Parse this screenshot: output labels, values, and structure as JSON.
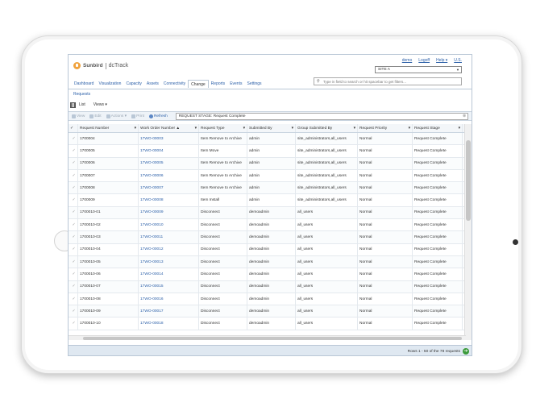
{
  "header": {
    "brand": "Sunbird",
    "product": "dcTrack",
    "links": [
      "demo",
      "Logoff",
      "Help ▾",
      "U.S."
    ],
    "site": "SITE A",
    "search_placeholder": "Type in field to search or hit spacebar to get filters..."
  },
  "nav": {
    "tabs": [
      "Dashboard",
      "Visualization",
      "Capacity",
      "Assets",
      "Connectivity",
      "Change",
      "Reports",
      "Events",
      "Settings"
    ],
    "active": "Change"
  },
  "subnav": {
    "requests": "Requests"
  },
  "listbar": {
    "list": "List",
    "views": "Views ▾"
  },
  "toolbar": {
    "view": "View",
    "edit": "Edit",
    "actions": "Actions ▾",
    "print": "Print",
    "refresh": "Refresh",
    "filter": "REQUEST STAGE:  Request Complete",
    "filter_clear": "⊗"
  },
  "grid": {
    "columns": [
      "Request Number",
      "Work Order Number ▲",
      "Request Type",
      "Submitted By",
      "Group Submitted By",
      "Request Priority",
      "Request Stage"
    ],
    "rows": [
      [
        "1700004",
        "17WO-00003",
        "Item Remove to Archive",
        "admin",
        "site_administrators,all_users",
        "Normal",
        "Request Complete"
      ],
      [
        "1700005",
        "17WO-00004",
        "Item Move",
        "admin",
        "site_administrators,all_users",
        "Normal",
        "Request Complete"
      ],
      [
        "1700006",
        "17WO-00005",
        "Item Remove to Archive",
        "admin",
        "site_administrators,all_users",
        "Normal",
        "Request Complete"
      ],
      [
        "1700007",
        "17WO-00006",
        "Item Remove to Archive",
        "admin",
        "site_administrators,all_users",
        "Normal",
        "Request Complete"
      ],
      [
        "1700008",
        "17WO-00007",
        "Item Remove to Archive",
        "admin",
        "site_administrators,all_users",
        "Normal",
        "Request Complete"
      ],
      [
        "1700009",
        "17WO-00008",
        "Item Install",
        "admin",
        "site_administrators,all_users",
        "Normal",
        "Request Complete"
      ],
      [
        "1700010-01",
        "17WO-00009",
        "Disconnect",
        "demoadmin",
        "all_users",
        "Normal",
        "Request Complete"
      ],
      [
        "1700010-02",
        "17WO-00010",
        "Disconnect",
        "demoadmin",
        "all_users",
        "Normal",
        "Request Complete"
      ],
      [
        "1700010-03",
        "17WO-00011",
        "Disconnect",
        "demoadmin",
        "all_users",
        "Normal",
        "Request Complete"
      ],
      [
        "1700010-04",
        "17WO-00012",
        "Disconnect",
        "demoadmin",
        "all_users",
        "Normal",
        "Request Complete"
      ],
      [
        "1700010-05",
        "17WO-00013",
        "Disconnect",
        "demoadmin",
        "all_users",
        "Normal",
        "Request Complete"
      ],
      [
        "1700010-06",
        "17WO-00014",
        "Disconnect",
        "demoadmin",
        "all_users",
        "Normal",
        "Request Complete"
      ],
      [
        "1700010-07",
        "17WO-00015",
        "Disconnect",
        "demoadmin",
        "all_users",
        "Normal",
        "Request Complete"
      ],
      [
        "1700010-08",
        "17WO-00016",
        "Disconnect",
        "demoadmin",
        "all_users",
        "Normal",
        "Request Complete"
      ],
      [
        "1700010-09",
        "17WO-00017",
        "Disconnect",
        "demoadmin",
        "all_users",
        "Normal",
        "Request Complete"
      ],
      [
        "1700010-10",
        "17WO-00018",
        "Disconnect",
        "demoadmin",
        "all_users",
        "Normal",
        "Request Complete"
      ]
    ]
  },
  "footer": {
    "count": "Rows 1 - 50 of the 78 requests"
  }
}
